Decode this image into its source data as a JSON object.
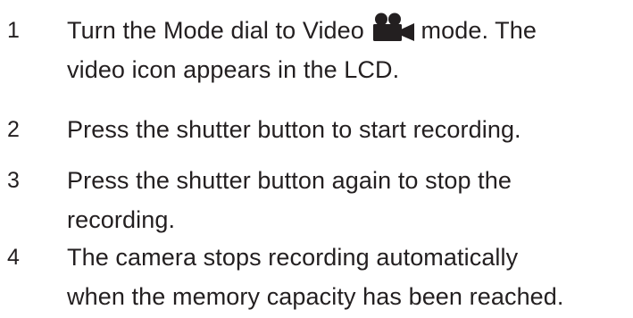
{
  "steps": [
    {
      "number": "1",
      "lines": [
        "Turn the Mode dial to Video",
        "mode. The",
        "video icon appears in the LCD."
      ],
      "icon": "video-camera-icon"
    },
    {
      "number": "2",
      "lines": [
        "Press the shutter button to start recording."
      ]
    },
    {
      "number": "3",
      "lines": [
        "Press the shutter button again to stop the",
        "recording."
      ]
    },
    {
      "number": "4",
      "lines": [
        "The camera stops recording automatically",
        "when the memory capacity has been reached."
      ]
    }
  ],
  "colors": {
    "text": "#231f20",
    "icon": "#231f20",
    "background": "#ffffff"
  }
}
